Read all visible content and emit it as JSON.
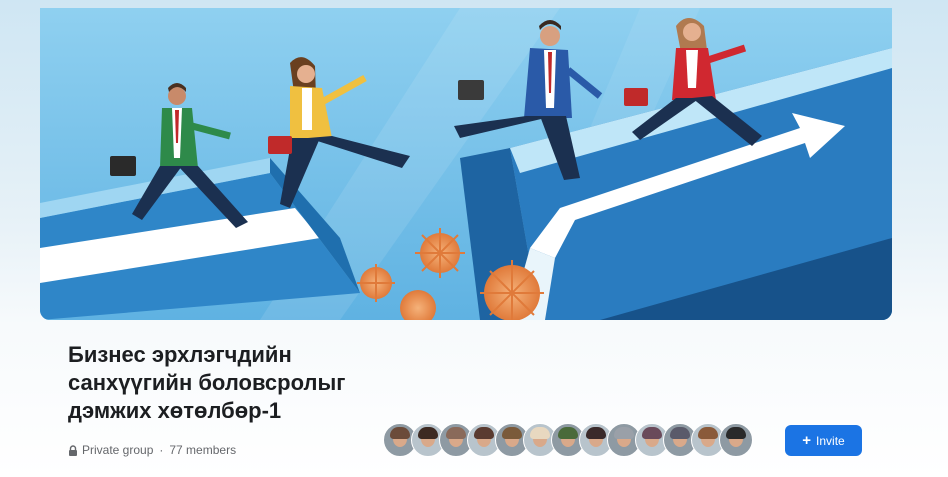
{
  "group": {
    "title_lines": [
      "Бизнес эрхлэгчдийн",
      "санхүүгийн боловсролыг",
      "дэмжих хөтөлбөр-1"
    ],
    "privacy": "Private group",
    "separator": "·",
    "members": "77 members"
  },
  "cover": {
    "description_icon": "cover-illustration"
  },
  "members_preview": {
    "count_shown": 13,
    "avatar_colors": [
      "#6b4b3a",
      "#3d2a22",
      "#8a6a5a",
      "#5a3b30",
      "#7a5a3a",
      "#e8d8c0",
      "#4a6a3a",
      "#3a2a2a",
      "#9aa0a8",
      "#6a4a5a",
      "#5a5a6a",
      "#8a5a3a",
      "#2a2a2a"
    ]
  },
  "actions": {
    "invite_label": "Invite",
    "invite_icon": "plus-icon"
  },
  "colors": {
    "accent": "#1b74e4",
    "title": "#1c1e21",
    "meta": "#65676b"
  }
}
